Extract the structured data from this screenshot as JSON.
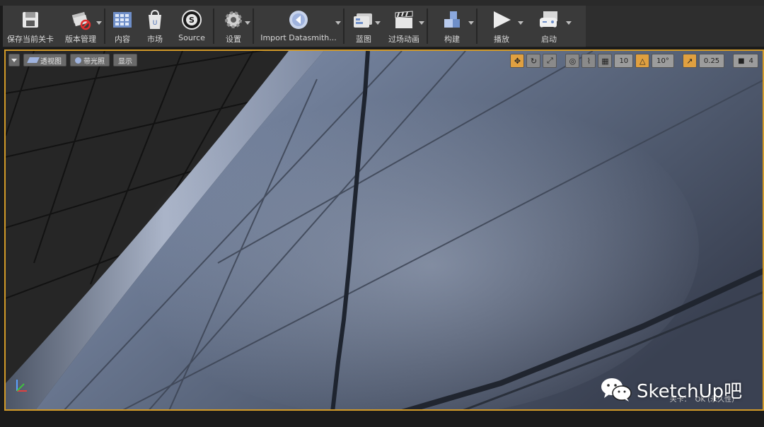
{
  "toolbar": {
    "items": [
      {
        "label": "保存当前关卡",
        "icon": "floppy-disk-icon",
        "dropdown": false
      },
      {
        "label": "版本管理",
        "icon": "source-control-icon",
        "dropdown": true
      },
      {
        "label": "内容",
        "icon": "content-grid-icon",
        "dropdown": false
      },
      {
        "label": "市场",
        "icon": "marketplace-icon",
        "dropdown": false
      },
      {
        "label": "Source",
        "icon": "source-logo-icon",
        "dropdown": false
      },
      {
        "label": "设置",
        "icon": "settings-gear-icon",
        "dropdown": true
      },
      {
        "label": "Import Datasmith...",
        "icon": "datasmith-icon",
        "dropdown": true
      },
      {
        "label": "蓝图",
        "icon": "blueprint-icon",
        "dropdown": true
      },
      {
        "label": "过场动画",
        "icon": "clapperboard-icon",
        "dropdown": true
      },
      {
        "label": "构建",
        "icon": "build-cubes-icon",
        "dropdown": true
      },
      {
        "label": "播放",
        "icon": "play-icon",
        "dropdown": true
      },
      {
        "label": "启动",
        "icon": "launch-gamepad-icon",
        "dropdown": true
      }
    ]
  },
  "viewport": {
    "view_mode": "透视图",
    "lighting_mode": "带光照",
    "show": "显示",
    "grid_snap": "10",
    "rotation_snap": "10°",
    "scale_snap": "0.25",
    "camera_speed": "4",
    "level_label": "关卡：",
    "level_value": "OK (永久性)"
  },
  "watermark": {
    "text": "SketchUp吧"
  },
  "colors": {
    "accent": "#d29a28",
    "toolbar_bg": "#3a3a3a",
    "button_bg": "#6a6a6a"
  }
}
